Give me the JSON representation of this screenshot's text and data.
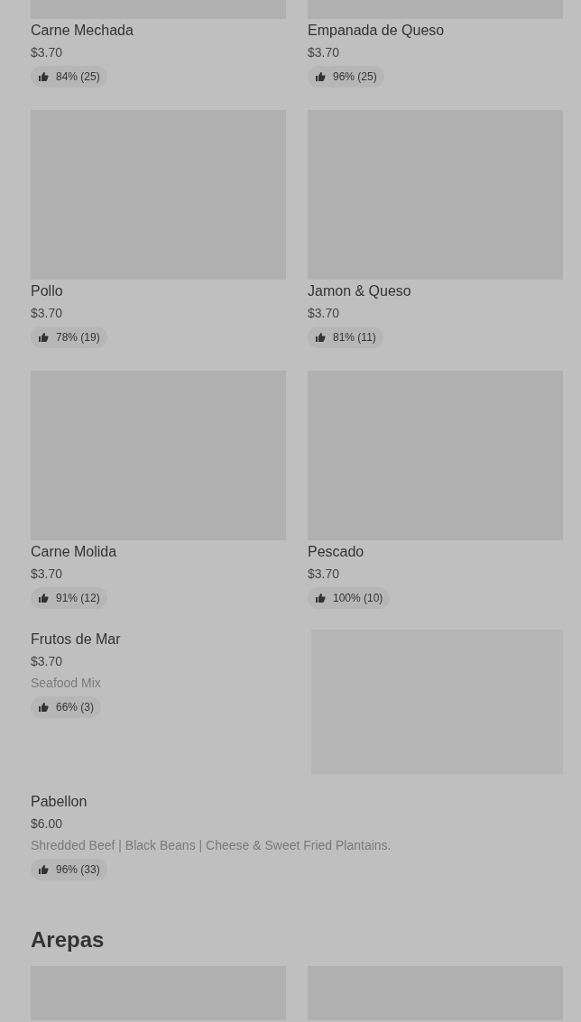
{
  "sections": [
    {
      "items": [
        {
          "kind": "card",
          "name": "Carne Mechada",
          "price": "$3.70",
          "rating": "84% (25)"
        },
        {
          "kind": "card",
          "name": "Empanada de Queso",
          "price": "$3.70",
          "rating": "96% (25)"
        },
        {
          "kind": "card",
          "name": "Pollo",
          "price": "$3.70",
          "rating": "78% (19)"
        },
        {
          "kind": "card",
          "name": "Jamon & Queso",
          "price": "$3.70",
          "rating": "81% (11)"
        },
        {
          "kind": "card",
          "name": "Carne Molida",
          "price": "$3.70",
          "rating": "91% (12)"
        },
        {
          "kind": "card",
          "name": "Pescado",
          "price": "$3.70",
          "rating": "100% (10)"
        },
        {
          "kind": "row_image",
          "name": "Frutos de Mar",
          "price": "$3.70",
          "description": "Seafood Mix",
          "rating": "66% (3)"
        },
        {
          "kind": "row",
          "name": "Pabellon",
          "price": "$6.00",
          "description": "Shredded Beef | Black Beans | Cheese & Sweet Fried Plantains.",
          "rating": "96% (33)"
        }
      ]
    },
    {
      "heading": "Arepas",
      "items": [
        {
          "kind": "image_only"
        },
        {
          "kind": "image_only"
        }
      ]
    }
  ]
}
